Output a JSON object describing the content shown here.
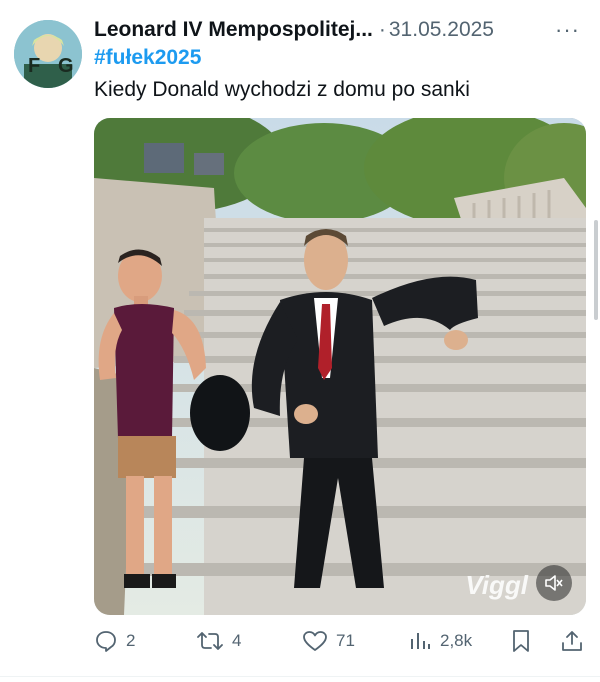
{
  "tweet": {
    "author_name": "Leonard IV Mempospolitej...",
    "separator": "·",
    "date": "31.05.2025",
    "more_label": "···",
    "hashtag": "#fułek2025",
    "text": "Kiedy Donald wychodzi z domu po sanki"
  },
  "media": {
    "watermark": "Viggl",
    "mute_icon": "speaker-muted-icon"
  },
  "actions": {
    "replies": "2",
    "reposts": "4",
    "likes": "71",
    "views": "2,8k"
  },
  "colors": {
    "accent": "#1d9bf0",
    "muted_text": "#536471",
    "text": "#0f1419"
  }
}
